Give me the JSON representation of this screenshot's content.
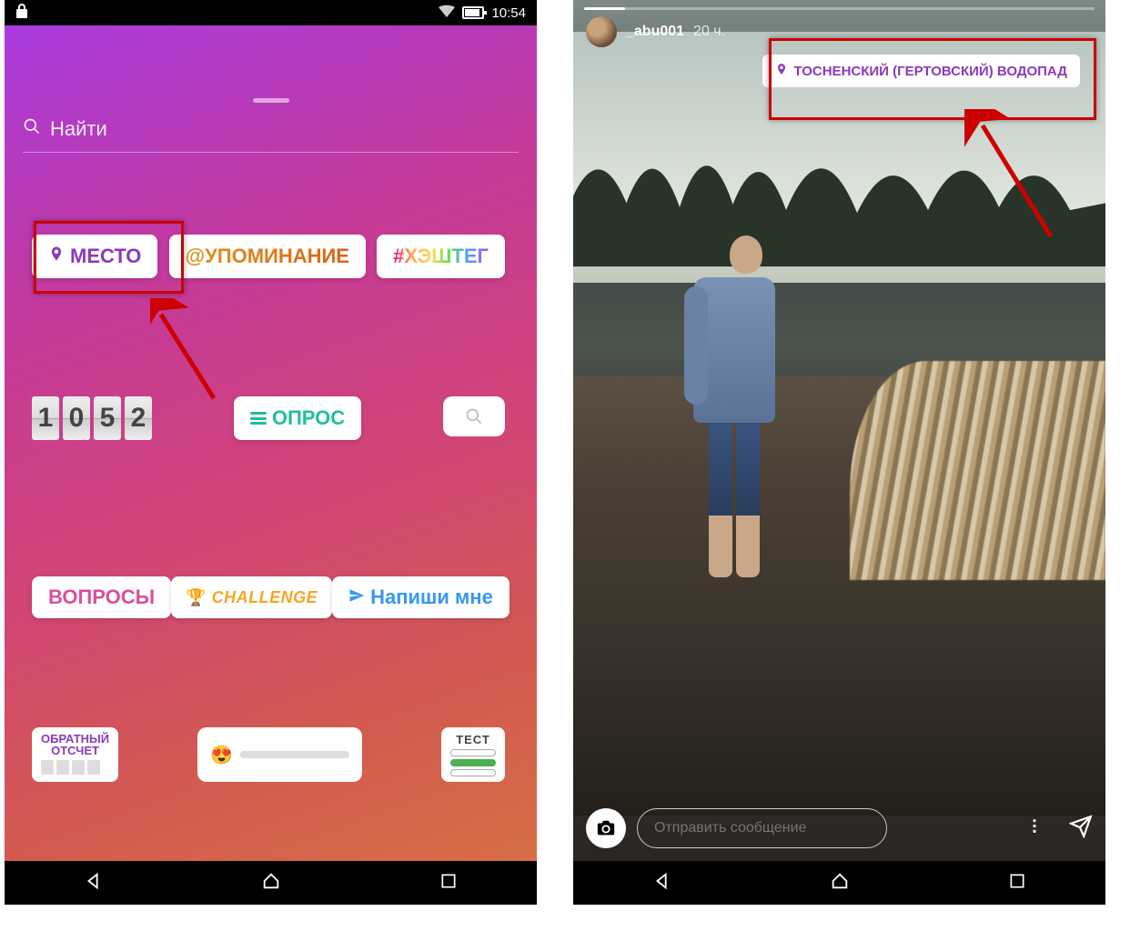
{
  "left": {
    "status": {
      "time": "10:54"
    },
    "search": {
      "placeholder": "Найти"
    },
    "stickers": {
      "location": "МЕСТО",
      "mention": "@УПОМИНАНИЕ",
      "hashtag": "#ХЭШТЕГ",
      "clock_digits": [
        "1",
        "0",
        "5",
        "2"
      ],
      "poll": "ОПРОС",
      "questions": "ВОПРОСЫ",
      "challenge": "CHALLENGE",
      "write_me": "Напиши мне",
      "countdown_l1": "ОБРАТНЫЙ",
      "countdown_l2": "ОТСЧЕТ",
      "test": "ТЕСТ"
    }
  },
  "right": {
    "user": "_abu001",
    "time_ago": "20 ч.",
    "location": "ТОСНЕНСКИЙ (ГЕРТОВСКИЙ) ВОДОПАД",
    "reply_placeholder": "Отправить сообщение"
  }
}
